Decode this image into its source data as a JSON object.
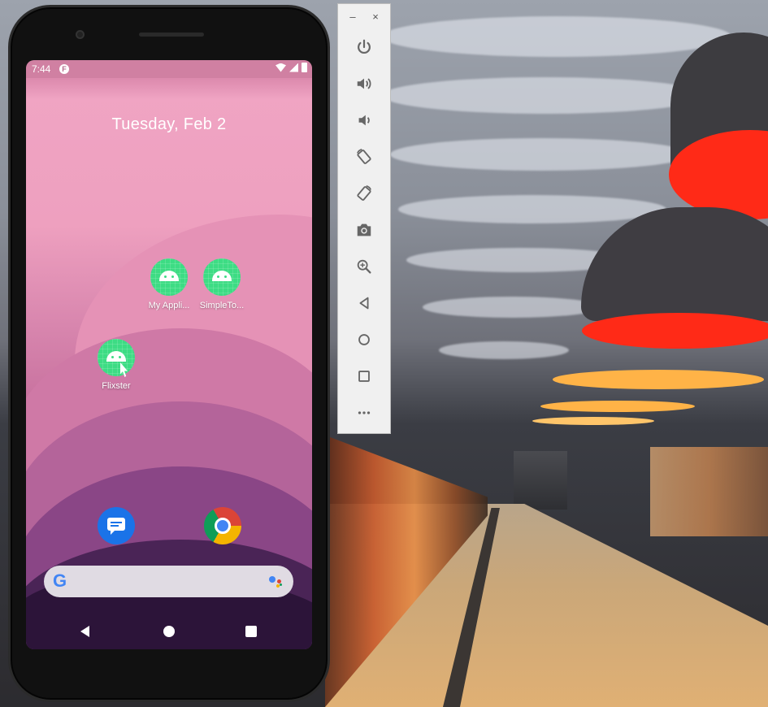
{
  "phone": {
    "status_bar": {
      "time": "7:44",
      "notification_icon": "F"
    },
    "home": {
      "date": "Tuesday, Feb 2"
    },
    "apps": [
      {
        "label": "My Appli...",
        "icon": "android-app-icon"
      },
      {
        "label": "SimpleTo...",
        "icon": "android-app-icon"
      },
      {
        "label": "Flixster",
        "icon": "android-app-icon"
      }
    ],
    "dock": [
      {
        "name": "Messages",
        "icon": "messages-icon"
      },
      {
        "name": "Chrome",
        "icon": "chrome-icon"
      }
    ],
    "search_bar": {
      "logo": "G"
    },
    "nav": [
      "back",
      "home",
      "recents"
    ]
  },
  "toolbar": {
    "window_controls": {
      "minimize": "–",
      "close": "×"
    },
    "tools": [
      {
        "name": "power",
        "icon": "power-icon"
      },
      {
        "name": "volume-up",
        "icon": "volume-up-icon"
      },
      {
        "name": "volume-down",
        "icon": "volume-down-icon"
      },
      {
        "name": "rotate-left",
        "icon": "rotate-left-icon"
      },
      {
        "name": "rotate-right",
        "icon": "rotate-right-icon"
      },
      {
        "name": "screenshot",
        "icon": "camera-icon"
      },
      {
        "name": "zoom",
        "icon": "zoom-icon"
      },
      {
        "name": "back",
        "icon": "back-icon"
      },
      {
        "name": "home",
        "icon": "home-icon"
      },
      {
        "name": "overview",
        "icon": "overview-icon"
      },
      {
        "name": "more",
        "icon": "more-icon"
      }
    ]
  },
  "colors": {
    "android_green": "#3ddc84",
    "lamp_red": "#ff2a17",
    "lamp_amber": "#ffb347"
  }
}
